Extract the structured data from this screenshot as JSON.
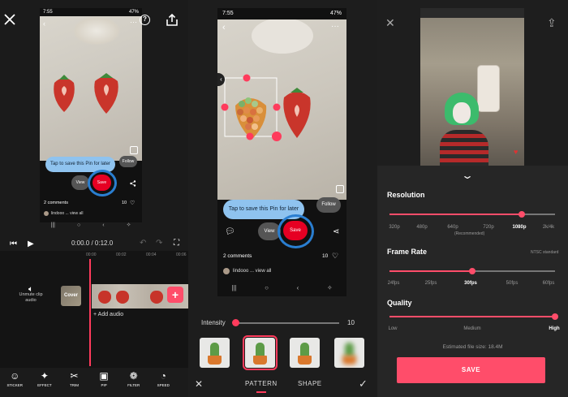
{
  "panel1": {
    "status_time": "7:55",
    "status_battery": "47%",
    "tooltip": "Tap to save this Pin for later",
    "follow_label": "Follow",
    "view_label": "View",
    "save_label": "Save",
    "comments": "2 comments",
    "like_count": "10",
    "comment_preview": "lindooo ... view all",
    "time_display": "0:00.0 / 0:12.0",
    "ruler_ticks": [
      "00:00",
      "00:02",
      "00:04",
      "00:06"
    ],
    "unmute_label": "Unmute clip audio",
    "cover_label": "Cover",
    "add_audio": "+ Add audio",
    "tools": [
      {
        "label": "STICKER",
        "icon": "sticker-icon",
        "glyph": "☺"
      },
      {
        "label": "EFFECT",
        "icon": "magic-wand-icon",
        "glyph": "✦"
      },
      {
        "label": "TRIM",
        "icon": "scissors-icon",
        "glyph": "✂"
      },
      {
        "label": "PIP",
        "icon": "pip-icon",
        "glyph": "▣"
      },
      {
        "label": "FILTER",
        "icon": "filter-icon",
        "glyph": "❁"
      },
      {
        "label": "SPEED",
        "icon": "speed-icon",
        "glyph": "◔"
      }
    ]
  },
  "panel2": {
    "status_time": "7:55",
    "status_battery": "47%",
    "tooltip": "Tap to save this Pin for later",
    "follow_label": "Follow",
    "view_label": "View",
    "save_label": "Save",
    "comments": "2 comments",
    "like_count": "10",
    "comment_preview": "lindooo ... view all",
    "intensity_label": "Intensity",
    "intensity_value": "10",
    "intensity_fraction": 0.0,
    "thumbnails": [
      {
        "name": "cactus-original",
        "selected": false,
        "blur": false
      },
      {
        "name": "cactus-pattern",
        "selected": true,
        "blur": false
      },
      {
        "name": "cactus-shape",
        "selected": false,
        "blur": false
      },
      {
        "name": "cactus-blur",
        "selected": false,
        "blur": true
      }
    ],
    "tabs": [
      "PATTERN",
      "SHAPE"
    ],
    "active_tab": "PATTERN"
  },
  "panel3": {
    "resolution_label": "Resolution",
    "resolution_options": [
      "320p",
      "480p",
      "640p",
      "720p",
      "1080p",
      "2k/4k"
    ],
    "resolution_recommended": "(Recommended)",
    "resolution_selected": "1080p",
    "framerate_label": "Frame Rate",
    "framerate_note": "NTSC standard",
    "framerate_options": [
      "24fps",
      "25fps",
      "30fps",
      "50fps",
      "60fps"
    ],
    "framerate_selected": "30fps",
    "quality_label": "Quality",
    "quality_options": [
      "Low",
      "Medium",
      "High"
    ],
    "quality_selected": "High",
    "estimate": "Estimated file size: 18.4M",
    "save_label": "SAVE"
  },
  "colors": {
    "accent": "#ff4d6a",
    "pinterest_red": "#e60023",
    "highlight_blue": "#2a7ed0",
    "tooltip_blue": "#8fc3ef"
  }
}
